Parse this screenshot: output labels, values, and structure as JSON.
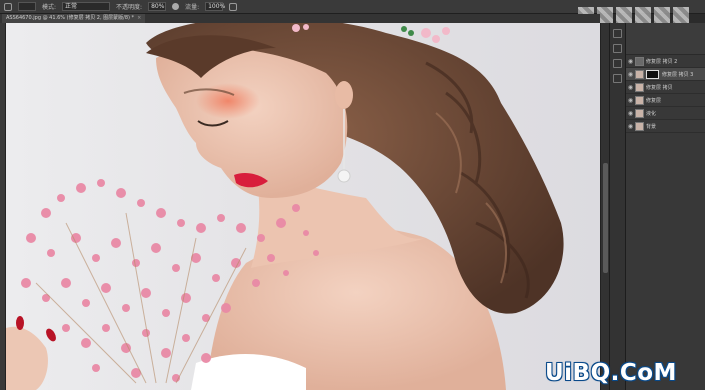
{
  "app": {
    "name": "Photoshop"
  },
  "options_bar": {
    "mode_label": "模式:",
    "mode_value": "正常",
    "opacity_label": "不透明度:",
    "opacity_value": "80%",
    "flow_label": "流量:",
    "flow_value": "100%"
  },
  "document_tab": {
    "title": "ASS64670.jpg @ 41.6% (修复层 拷贝 2, 图层蒙版/8) *",
    "close": "×"
  },
  "layers": [
    {
      "name": "修复层 拷贝 2",
      "has_mask": false,
      "active": false,
      "thumb_color": "#6a6a6a"
    },
    {
      "name": "修复层 拷贝 3",
      "has_mask": true,
      "active": true,
      "thumb_color": "#c9b3a8"
    },
    {
      "name": "修复层 拷贝",
      "has_mask": false,
      "active": false,
      "thumb_color": "#c9b3a8"
    },
    {
      "name": "修复层",
      "has_mask": false,
      "active": false,
      "thumb_color": "#c9b3a8"
    },
    {
      "name": "液化",
      "has_mask": false,
      "active": false,
      "thumb_color": "#c9b3a8"
    },
    {
      "name": "背景",
      "has_mask": false,
      "active": false,
      "thumb_color": "#c9b3a8"
    }
  ],
  "watermark_logo": "UiBQ.CoM",
  "icons": {
    "brush": "brush-icon",
    "airbrush": "airbrush-icon",
    "pressure": "pressure-icon",
    "eye": "eye-icon"
  }
}
